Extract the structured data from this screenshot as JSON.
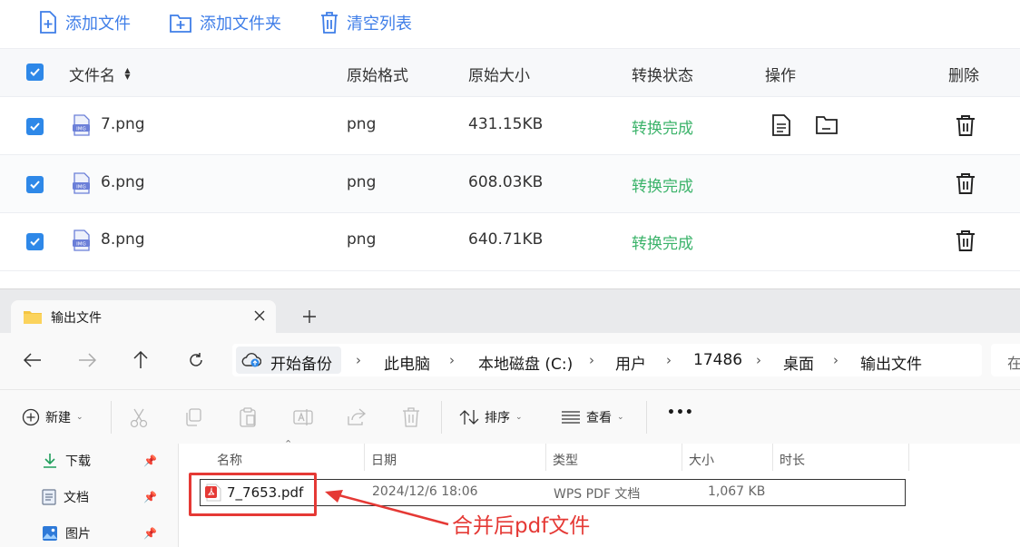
{
  "toolbar": {
    "add_file": "添加文件",
    "add_folder": "添加文件夹",
    "clear_list": "清空列表"
  },
  "table": {
    "headers": {
      "filename": "文件名",
      "sort_glyph": "▲▼",
      "format": "原始格式",
      "size": "原始大小",
      "status": "转换状态",
      "action": "操作",
      "delete": "删除"
    },
    "rows": [
      {
        "name": "7.png",
        "format": "png",
        "size": "431.15KB",
        "status": "转换完成",
        "checked": true
      },
      {
        "name": "6.png",
        "format": "png",
        "size": "608.03KB",
        "status": "转换完成",
        "checked": true
      },
      {
        "name": "8.png",
        "format": "png",
        "size": "640.71KB",
        "status": "转换完成",
        "checked": true
      }
    ],
    "img_icon_label": "IMG"
  },
  "explorer": {
    "tab_title": "输出文件",
    "breadcrumbs": [
      "开始备份",
      "此电脑",
      "本地磁盘 (C:)",
      "用户",
      "17486",
      "桌面",
      "输出文件"
    ],
    "search_partial": "在",
    "commands": {
      "new": "新建",
      "sort": "排序",
      "view": "查看",
      "more": "•••"
    },
    "sidebar": [
      {
        "label": "下载"
      },
      {
        "label": "文档"
      },
      {
        "label": "图片"
      }
    ],
    "columns": {
      "name": "名称",
      "date": "日期",
      "type": "类型",
      "size": "大小",
      "duration": "时长"
    },
    "file": {
      "name": "7_7653.pdf",
      "date": "2024/12/6 18:06",
      "type": "WPS PDF 文档",
      "size": "1,067 KB"
    }
  },
  "annotation": {
    "text": "合并后pdf文件",
    "color": "#e53935"
  },
  "colors": {
    "accent": "#3f7ee8",
    "checkbox": "#2e88e8",
    "success": "#3bb36a"
  }
}
